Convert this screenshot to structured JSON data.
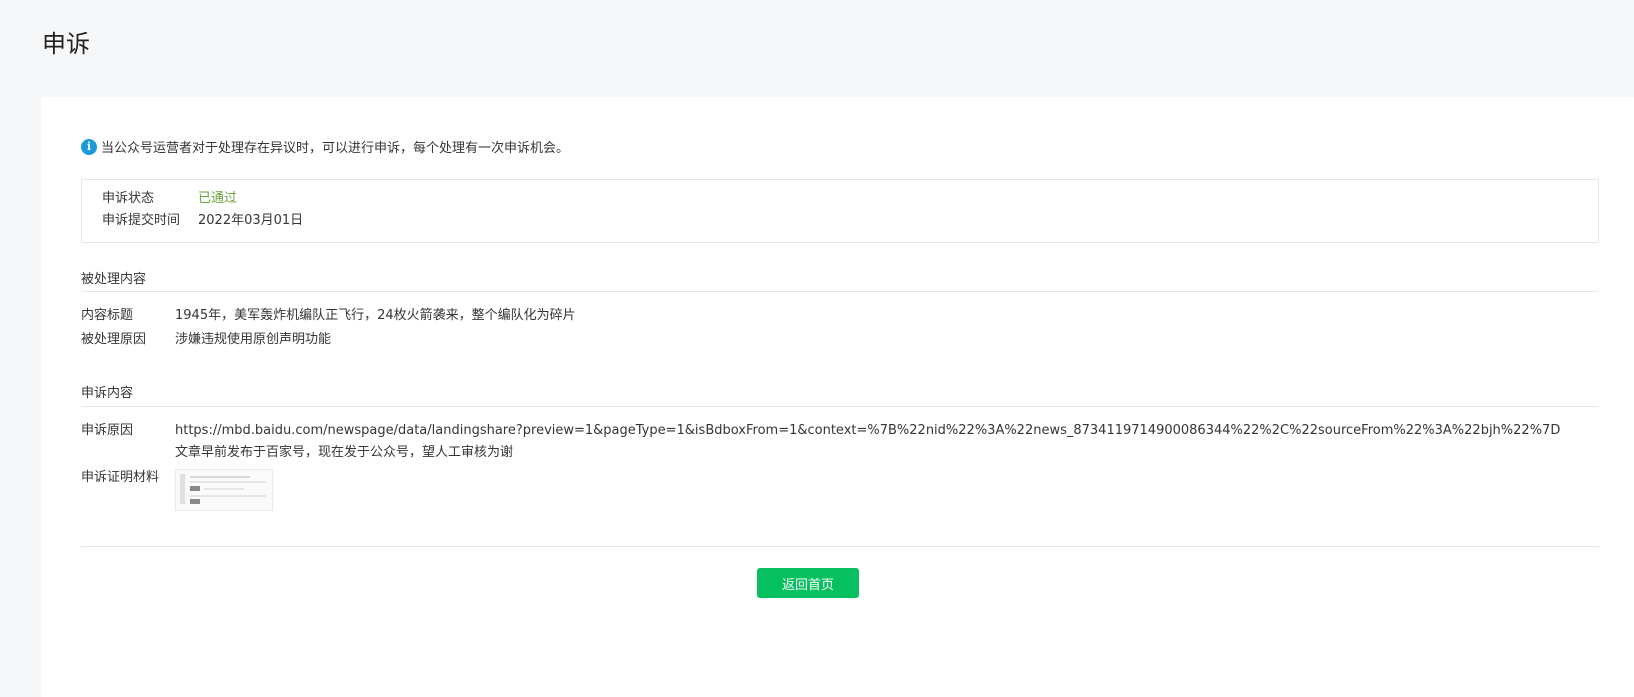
{
  "page": {
    "title": "申诉"
  },
  "notice": {
    "icon": "info-icon",
    "text": "当公众号运营者对于处理存在异议时，可以进行申诉，每个处理有一次申诉机会。"
  },
  "status": {
    "state_label": "申诉状态",
    "state_value": "已通过",
    "state_color": "#6aa33a",
    "time_label": "申诉提交时间",
    "time_value": "2022年03月01日"
  },
  "handled_content": {
    "section_title": "被处理内容",
    "title_label": "内容标题",
    "title_value": "1945年，美军轰炸机编队正飞行，24枚火箭袭来，整个编队化为碎片",
    "reason_label": "被处理原因",
    "reason_value": "涉嫌违规使用原创声明功能"
  },
  "appeal_content": {
    "section_title": "申诉内容",
    "reason_label": "申诉原因",
    "reason_value": "https://mbd.baidu.com/newspage/data/landingshare?preview=1&pageType=1&isBdboxFrom=1&context=%7B%22nid%22%3A%22news_8734119714900086344%22%2C%22sourceFrom%22%3A%22bjh%22%7D 文章早前发布于百家号，现在发于公众号，望人工审核为谢",
    "evidence_label": "申诉证明材料"
  },
  "actions": {
    "back_label": "返回首页",
    "accent_color": "#07c160"
  }
}
